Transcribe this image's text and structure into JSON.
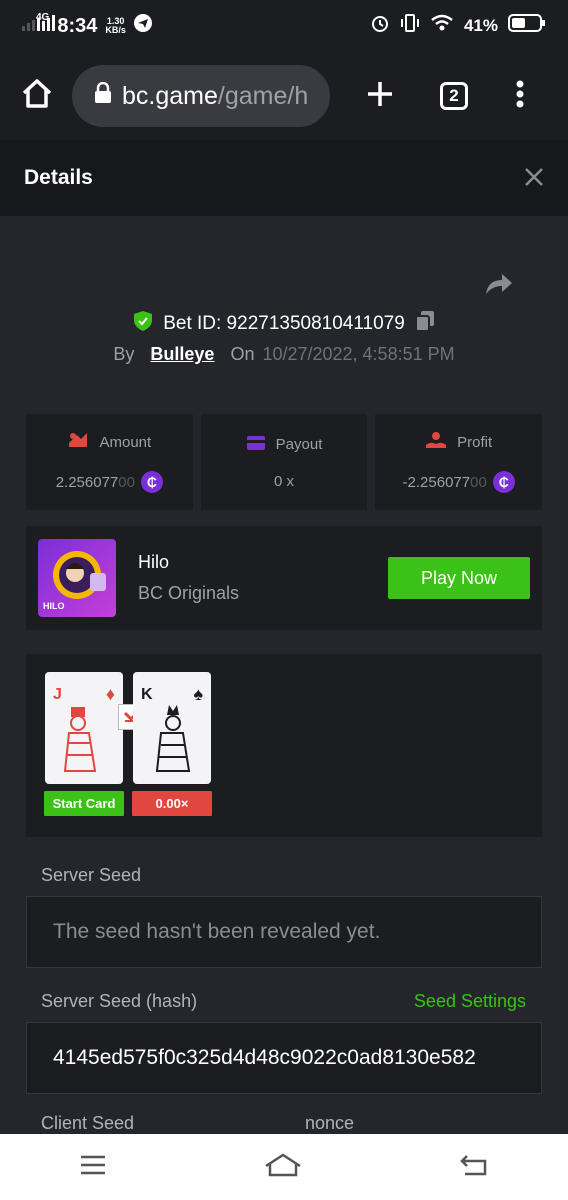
{
  "status_bar": {
    "network": "4G",
    "time": "8:34",
    "speed_value": "1.30",
    "speed_unit": "KB/s",
    "battery": "41%"
  },
  "browser": {
    "url_host": "bc.game",
    "url_path": "/game/h",
    "tab_count": "2"
  },
  "header": {
    "title": "Details",
    "close_icon": "close-icon"
  },
  "bet": {
    "id_label": "Bet ID: 92271350810411079",
    "by_label": "By",
    "user": "Bulleye",
    "on_label": "On",
    "date": "10/27/2022, 4:58:51 PM"
  },
  "stats": {
    "amount_label": "Amount",
    "amount_value": "2.25607700",
    "amount_main": "2.256077",
    "amount_tail": "00",
    "payout_label": "Payout",
    "payout_value": "0 x",
    "profit_label": "Profit",
    "profit_main": "-2.256077",
    "profit_tail": "00",
    "coin_symbol": "₵"
  },
  "game": {
    "thumb_label": "HILO",
    "name": "Hilo",
    "provider": "BC Originals",
    "play_label": "Play Now"
  },
  "cards": {
    "card1_rank": "J",
    "card1_suit": "♦",
    "card2_rank": "K",
    "card2_suit": "♠",
    "start_label": "Start Card",
    "multiplier": "0.00×"
  },
  "seeds": {
    "server_seed_label": "Server Seed",
    "server_seed_value": "The seed hasn't been revealed yet.",
    "hash_label": "Server Seed (hash)",
    "seed_settings_label": "Seed Settings",
    "hash_value": "4145ed575f0c325d4d48c9022c0ad8130e582",
    "client_seed_label": "Client Seed",
    "nonce_label": "nonce"
  },
  "colors": {
    "green": "#3bc117",
    "red": "#e2473f",
    "purple": "#7b2fd6"
  }
}
